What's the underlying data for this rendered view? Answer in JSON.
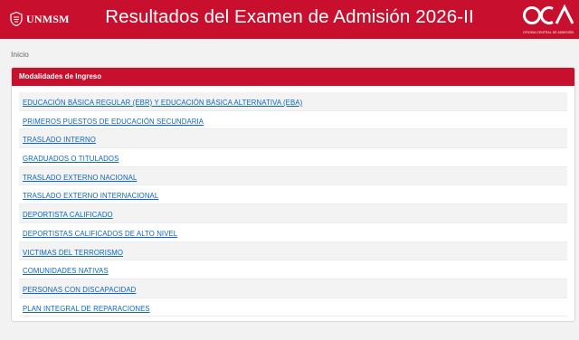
{
  "header": {
    "brand_left": "UNMSM",
    "title": "Resultados del Examen de Admisión 2026-II",
    "brand_right_sub": "OFICINA CENTRAL DE ADMISIÓN",
    "brand_right": "OCA"
  },
  "breadcrumb": "Inicio",
  "panel": {
    "title": "Modalidades de Ingreso",
    "items": [
      {
        "label": "EDUCACIÓN BÁSICA REGULAR (EBR) Y EDUCACIÓN BÁSICA ALTERNATIVA (EBA)"
      },
      {
        "label": "PRIMEROS PUESTOS DE EDUCACIÓN SECUNDARIA"
      },
      {
        "label": "TRASLADO INTERNO"
      },
      {
        "label": "GRADUADOS O TITULADOS"
      },
      {
        "label": "TRASLADO EXTERNO NACIONAL"
      },
      {
        "label": "TRASLADO EXTERNO INTERNACIONAL"
      },
      {
        "label": "DEPORTISTA CALIFICADO"
      },
      {
        "label": "DEPORTISTAS CALIFICADOS DE ALTO NIVEL"
      },
      {
        "label": "VICTIMAS DEL TERRORISMO"
      },
      {
        "label": "COMUNIDADES NATIVAS"
      },
      {
        "label": "PERSONAS CON DISCAPACIDAD"
      },
      {
        "label": "PLAN INTEGRAL DE REPARACIONES"
      }
    ]
  },
  "colors": {
    "brand_red": "#c8102e",
    "link_blue": "#0b66c3"
  }
}
